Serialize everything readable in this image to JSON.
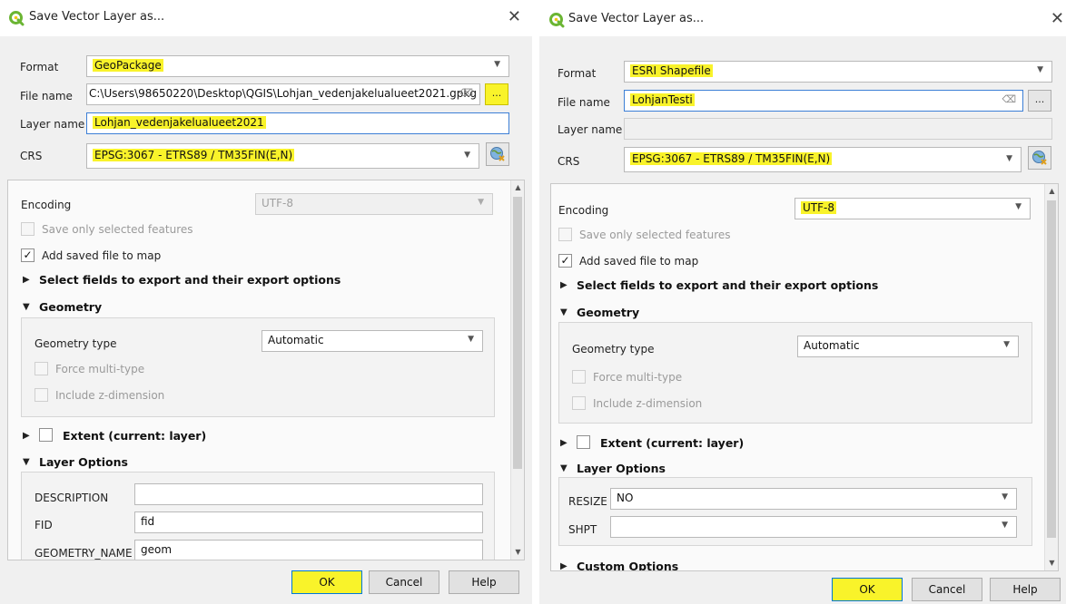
{
  "left": {
    "title": "Save Vector Layer as...",
    "format_label": "Format",
    "format_value": "GeoPackage",
    "filename_label": "File name",
    "filename_value": "C:\\Users\\98650220\\Desktop\\QGIS\\Lohjan_vedenjakelualueet2021.gpkg",
    "browse_label": "...",
    "layername_label": "Layer name",
    "layername_value": "Lohjan_vedenjakelualueet2021",
    "crs_label": "CRS",
    "crs_value": "EPSG:3067 - ETRS89 / TM35FIN(E,N)",
    "encoding_label": "Encoding",
    "encoding_value": "UTF-8",
    "save_selected_label": "Save only selected features",
    "add_to_map_label": "Add saved file to map",
    "select_fields_label": "Select fields to export and their export options",
    "geometry_label": "Geometry",
    "geometry_type_label": "Geometry type",
    "geometry_type_value": "Automatic",
    "force_multi_label": "Force multi-type",
    "include_z_label": "Include z-dimension",
    "extent_label": "Extent (current: layer)",
    "layer_options_label": "Layer Options",
    "description_label": "DESCRIPTION",
    "description_value": "",
    "fid_label": "FID",
    "fid_value": "fid",
    "geometry_name_label": "GEOMETRY_NAME",
    "geometry_name_value": "geom",
    "ok_label": "OK",
    "cancel_label": "Cancel",
    "help_label": "Help"
  },
  "right": {
    "title": "Save Vector Layer as...",
    "format_label": "Format",
    "format_value": "ESRI Shapefile",
    "filename_label": "File name",
    "filename_value": "LohjanTesti",
    "browse_label": "...",
    "layername_label": "Layer name",
    "layername_value": "",
    "crs_label": "CRS",
    "crs_value": "EPSG:3067 - ETRS89 / TM35FIN(E,N)",
    "encoding_label": "Encoding",
    "encoding_value": "UTF-8",
    "save_selected_label": "Save only selected features",
    "add_to_map_label": "Add saved file to map",
    "select_fields_label": "Select fields to export and their export options",
    "geometry_label": "Geometry",
    "geometry_type_label": "Geometry type",
    "geometry_type_value": "Automatic",
    "force_multi_label": "Force multi-type",
    "include_z_label": "Include z-dimension",
    "extent_label": "Extent (current: layer)",
    "layer_options_label": "Layer Options",
    "resize_label": "RESIZE",
    "resize_value": "NO",
    "shpt_label": "SHPT",
    "shpt_value": "",
    "custom_options_label": "Custom Options",
    "ok_label": "OK",
    "cancel_label": "Cancel",
    "help_label": "Help"
  },
  "colors": {
    "highlight": "#f9f32a",
    "qgis_green": "#6bb533",
    "focus_border": "#3c7fd6"
  },
  "icons": {
    "title": "qgis-logo-icon",
    "close": "close-icon",
    "crs": "crs-globe-icon",
    "dropdown": "chevron-down-icon",
    "clear": "clear-field-icon"
  }
}
